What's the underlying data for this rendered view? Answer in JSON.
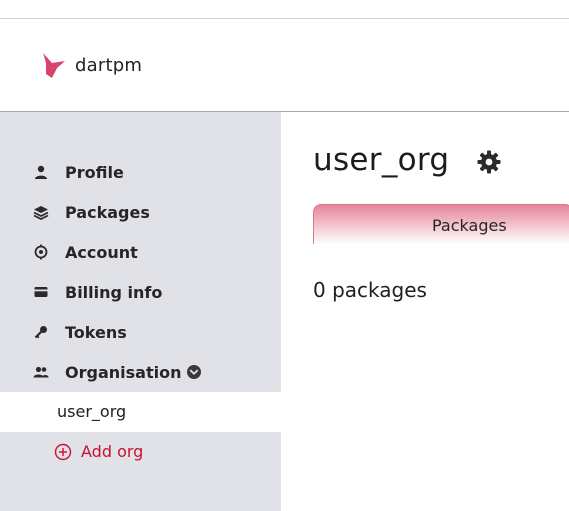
{
  "brand": {
    "name": "dartpm",
    "accent": "#d6456e"
  },
  "sidebar": {
    "items": [
      {
        "label": "Profile",
        "icon": "user-icon"
      },
      {
        "label": "Packages",
        "icon": "layers-icon"
      },
      {
        "label": "Account",
        "icon": "account-gear-icon"
      },
      {
        "label": "Billing info",
        "icon": "card-icon"
      },
      {
        "label": "Tokens",
        "icon": "key-icon"
      },
      {
        "label": "Organisation",
        "icon": "group-icon"
      }
    ],
    "org_item": "user_org",
    "add_org_label": "Add org"
  },
  "main": {
    "title": "user_org",
    "tabs": [
      {
        "label": "Packages"
      }
    ],
    "packages_count_label": "0 packages"
  },
  "colors": {
    "sidebar_bg": "#e1e2e8",
    "danger": "#c8102e",
    "tab_gradient": "#e4849a"
  }
}
